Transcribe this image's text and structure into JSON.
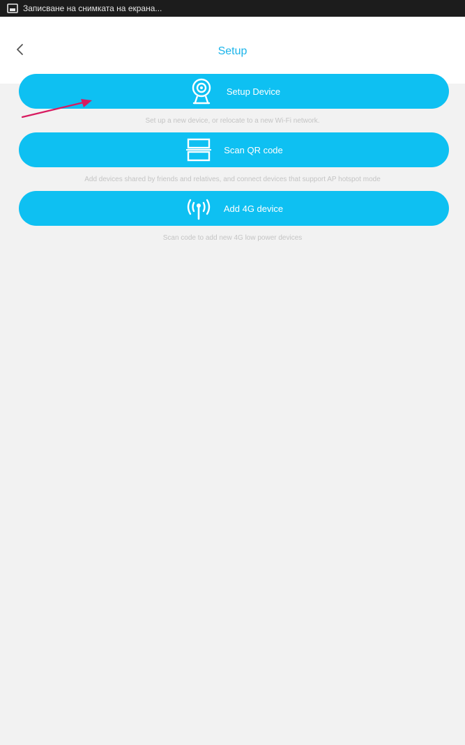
{
  "status_bar": {
    "icon": "screen-record-icon",
    "text": "Записване на снимката на екрана..."
  },
  "header": {
    "back_icon": "chevron-left-icon",
    "title": "Setup"
  },
  "options": [
    {
      "icon": "camera-icon",
      "label": "Setup Device",
      "description": "Set up a new device, or relocate to a new Wi-Fi network."
    },
    {
      "icon": "qr-scan-icon",
      "label": "Scan QR code",
      "description": "Add devices shared by friends and relatives, and connect devices that support AP hotspot mode"
    },
    {
      "icon": "antenna-signal-icon",
      "label": "Add 4G device",
      "description": "Scan code to add new 4G low power devices"
    }
  ],
  "colors": {
    "accent": "#0ec0f2",
    "title": "#1ab4ea",
    "background": "#f2f2f2",
    "annotation_arrow": "#d81b60"
  }
}
